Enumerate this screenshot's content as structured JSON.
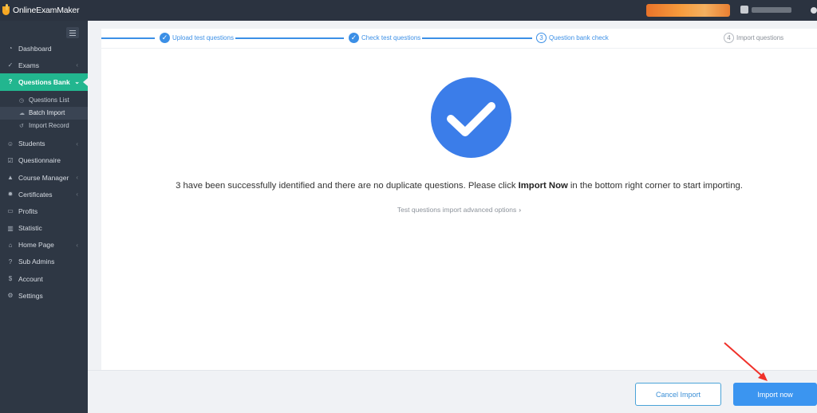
{
  "app": {
    "logo_text": "OnlineExamMaker"
  },
  "sidebar": {
    "items": [
      {
        "label": "Dashboard",
        "icon": "speedometer-icon"
      },
      {
        "label": "Exams",
        "icon": "check-circle-icon"
      },
      {
        "label": "Questions Bank",
        "icon": "question-circle-icon",
        "active": true
      },
      {
        "label": "Students",
        "icon": "users-icon"
      },
      {
        "label": "Questionnaire",
        "icon": "checkbox-icon"
      },
      {
        "label": "Course Manager",
        "icon": "graduation-cap-icon"
      },
      {
        "label": "Certificates",
        "icon": "badge-icon"
      },
      {
        "label": "Profits",
        "icon": "card-icon"
      },
      {
        "label": "Statistic",
        "icon": "bar-chart-icon"
      },
      {
        "label": "Home Page",
        "icon": "home-icon"
      },
      {
        "label": "Sub Admins",
        "icon": "help-circle-icon"
      },
      {
        "label": "Account",
        "icon": "dollar-icon"
      },
      {
        "label": "Settings",
        "icon": "gear-icon"
      }
    ],
    "sub_items": [
      {
        "label": "Questions List",
        "icon": "clock-icon"
      },
      {
        "label": "Batch Import",
        "icon": "cloud-upload-icon",
        "current": true
      },
      {
        "label": "Import Record",
        "icon": "history-icon"
      }
    ]
  },
  "steps": [
    {
      "number": "1",
      "label": "Upload test questions",
      "status": "done"
    },
    {
      "number": "2",
      "label": "Check test questions",
      "status": "done"
    },
    {
      "number": "3",
      "label": "Question bank check",
      "status": "current"
    },
    {
      "number": "4",
      "label": "Import questions",
      "status": "todo"
    }
  ],
  "result": {
    "message_before": "3 have been successfully identified and there are no duplicate questions. Please click ",
    "message_bold": "Import Now",
    "message_after": " in the bottom right corner to start importing.",
    "advanced_link": "Test questions import advanced options"
  },
  "footer": {
    "cancel_label": "Cancel Import",
    "import_label": "Import now"
  },
  "colors": {
    "primary": "#3b8fe6",
    "active_menu": "#22b68f",
    "sidebar_bg": "#2e3744",
    "annotation_arrow": "#f0312a"
  }
}
